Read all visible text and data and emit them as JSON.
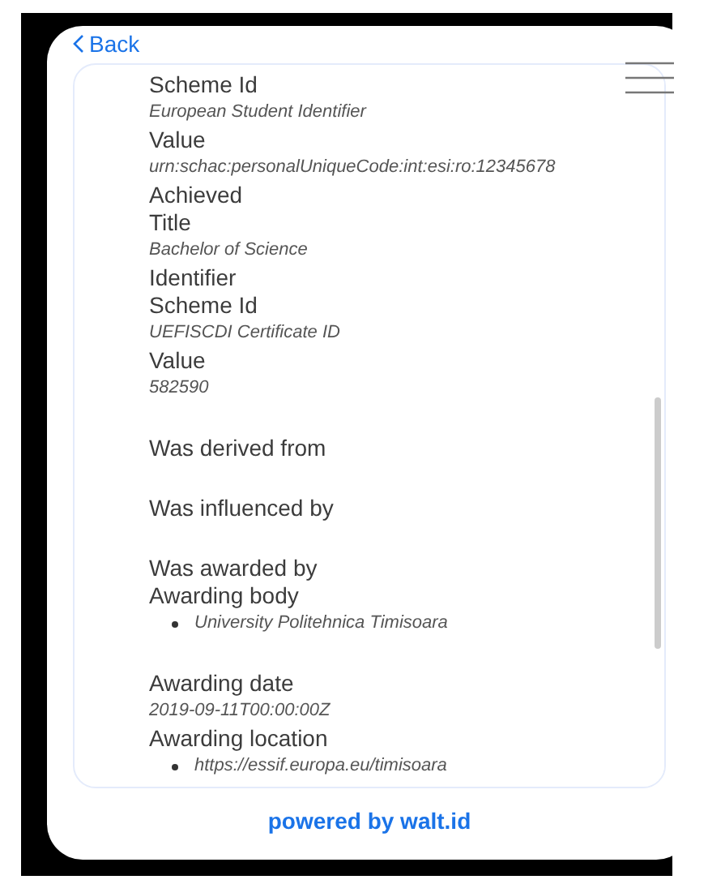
{
  "back": {
    "label": "Back"
  },
  "details": [
    {
      "kind": "field",
      "text": "Scheme Id"
    },
    {
      "kind": "value",
      "text": "European Student Identifier"
    },
    {
      "kind": "field",
      "text": "Value"
    },
    {
      "kind": "value",
      "text": "urn:schac:personalUniqueCode:int:esi:ro:12345678"
    },
    {
      "kind": "field",
      "text": "Achieved"
    },
    {
      "kind": "field",
      "text": "Title"
    },
    {
      "kind": "value",
      "text": "Bachelor of Science"
    },
    {
      "kind": "field",
      "text": "Identifier"
    },
    {
      "kind": "field",
      "text": "Scheme Id"
    },
    {
      "kind": "value",
      "text": "UEFISCDI Certificate ID"
    },
    {
      "kind": "field",
      "text": "Value"
    },
    {
      "kind": "value",
      "text": "582590"
    },
    {
      "kind": "section",
      "text": "Was derived from"
    },
    {
      "kind": "section",
      "text": "Was influenced by"
    },
    {
      "kind": "section",
      "text": "Was awarded by"
    },
    {
      "kind": "field",
      "text": "Awarding body"
    },
    {
      "kind": "bullet",
      "text": "University Politehnica Timisoara"
    },
    {
      "kind": "section",
      "text": "Awarding date"
    },
    {
      "kind": "value",
      "text": "2019-09-11T00:00:00Z"
    },
    {
      "kind": "field",
      "text": "Awarding location"
    },
    {
      "kind": "bullet",
      "text": "https://essif.europa.eu/timisoara"
    }
  ],
  "footer": {
    "link": "powered by walt.id"
  }
}
